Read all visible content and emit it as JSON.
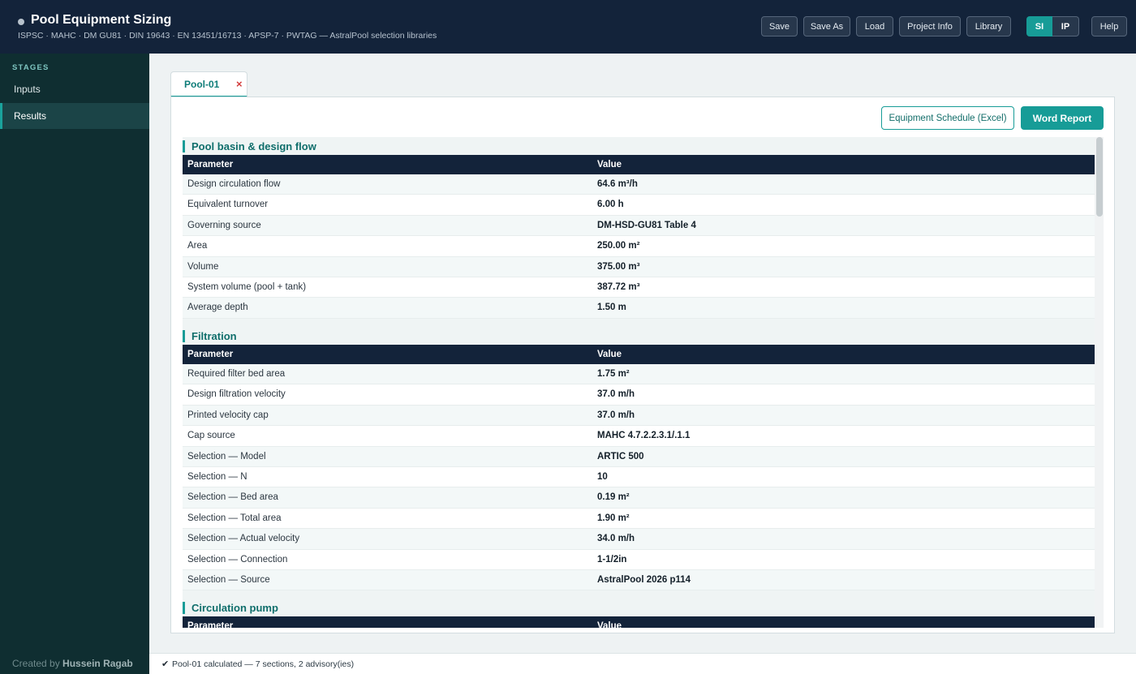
{
  "header": {
    "title": "Pool Equipment Sizing",
    "subtitle": "ISPSC · MAHC · DM GU81 · DIN 19643 · EN 13451/16713 · APSP-7 · PWTAG  —  AstralPool selection libraries",
    "buttons": {
      "save": "Save",
      "save_as": "Save As",
      "load": "Load",
      "project_info": "Project Info",
      "library": "Library",
      "help": "Help"
    },
    "units": {
      "si": "SI",
      "ip": "IP",
      "selected": "SI"
    }
  },
  "sidebar": {
    "heading": "STAGES",
    "items": [
      {
        "label": "Inputs"
      },
      {
        "label": "Results",
        "active": true
      }
    ],
    "credit_prefix": "Created by",
    "credit_name": "Hussein Ragab"
  },
  "tab": {
    "label": "Pool-01",
    "close": "×"
  },
  "actions": {
    "excel": "Equipment Schedule (Excel)",
    "word": "Word Report"
  },
  "table_headers": {
    "parameter": "Parameter",
    "value": "Value"
  },
  "sections": [
    {
      "title": "Pool basin & design flow",
      "rows": [
        [
          "Design circulation flow",
          "64.6 m³/h"
        ],
        [
          "Equivalent turnover",
          "6.00 h"
        ],
        [
          "Governing source",
          "DM-HSD-GU81 Table 4"
        ],
        [
          "Area",
          "250.00 m²"
        ],
        [
          "Volume",
          "375.00 m³"
        ],
        [
          "System volume (pool + tank)",
          "387.72 m³"
        ],
        [
          "Average depth",
          "1.50 m"
        ]
      ]
    },
    {
      "title": "Filtration",
      "rows": [
        [
          "Required filter bed area",
          "1.75 m²"
        ],
        [
          "Design filtration velocity",
          "37.0 m/h"
        ],
        [
          "Printed velocity cap",
          "37.0 m/h"
        ],
        [
          "Cap source",
          "MAHC 4.7.2.2.3.1/.1.1"
        ],
        [
          "Selection — Model",
          "ARTIC 500"
        ],
        [
          "Selection — N",
          "10"
        ],
        [
          "Selection — Bed area",
          "0.19 m²"
        ],
        [
          "Selection — Total area",
          "1.90 m²"
        ],
        [
          "Selection — Actual velocity",
          "34.0 m/h"
        ],
        [
          "Selection — Connection",
          "1-1/2in"
        ],
        [
          "Selection — Source",
          "AstralPool 2026 p114"
        ]
      ]
    },
    {
      "title": "Circulation pump",
      "rows": []
    }
  ],
  "status": {
    "check": "✔",
    "text": "Pool-01 calculated — 7 sections, 2 advisory(ies)"
  },
  "colors": {
    "accent": "#179c97",
    "header_bg": "#13233a",
    "sidebar_bg": "#0f2e31"
  }
}
